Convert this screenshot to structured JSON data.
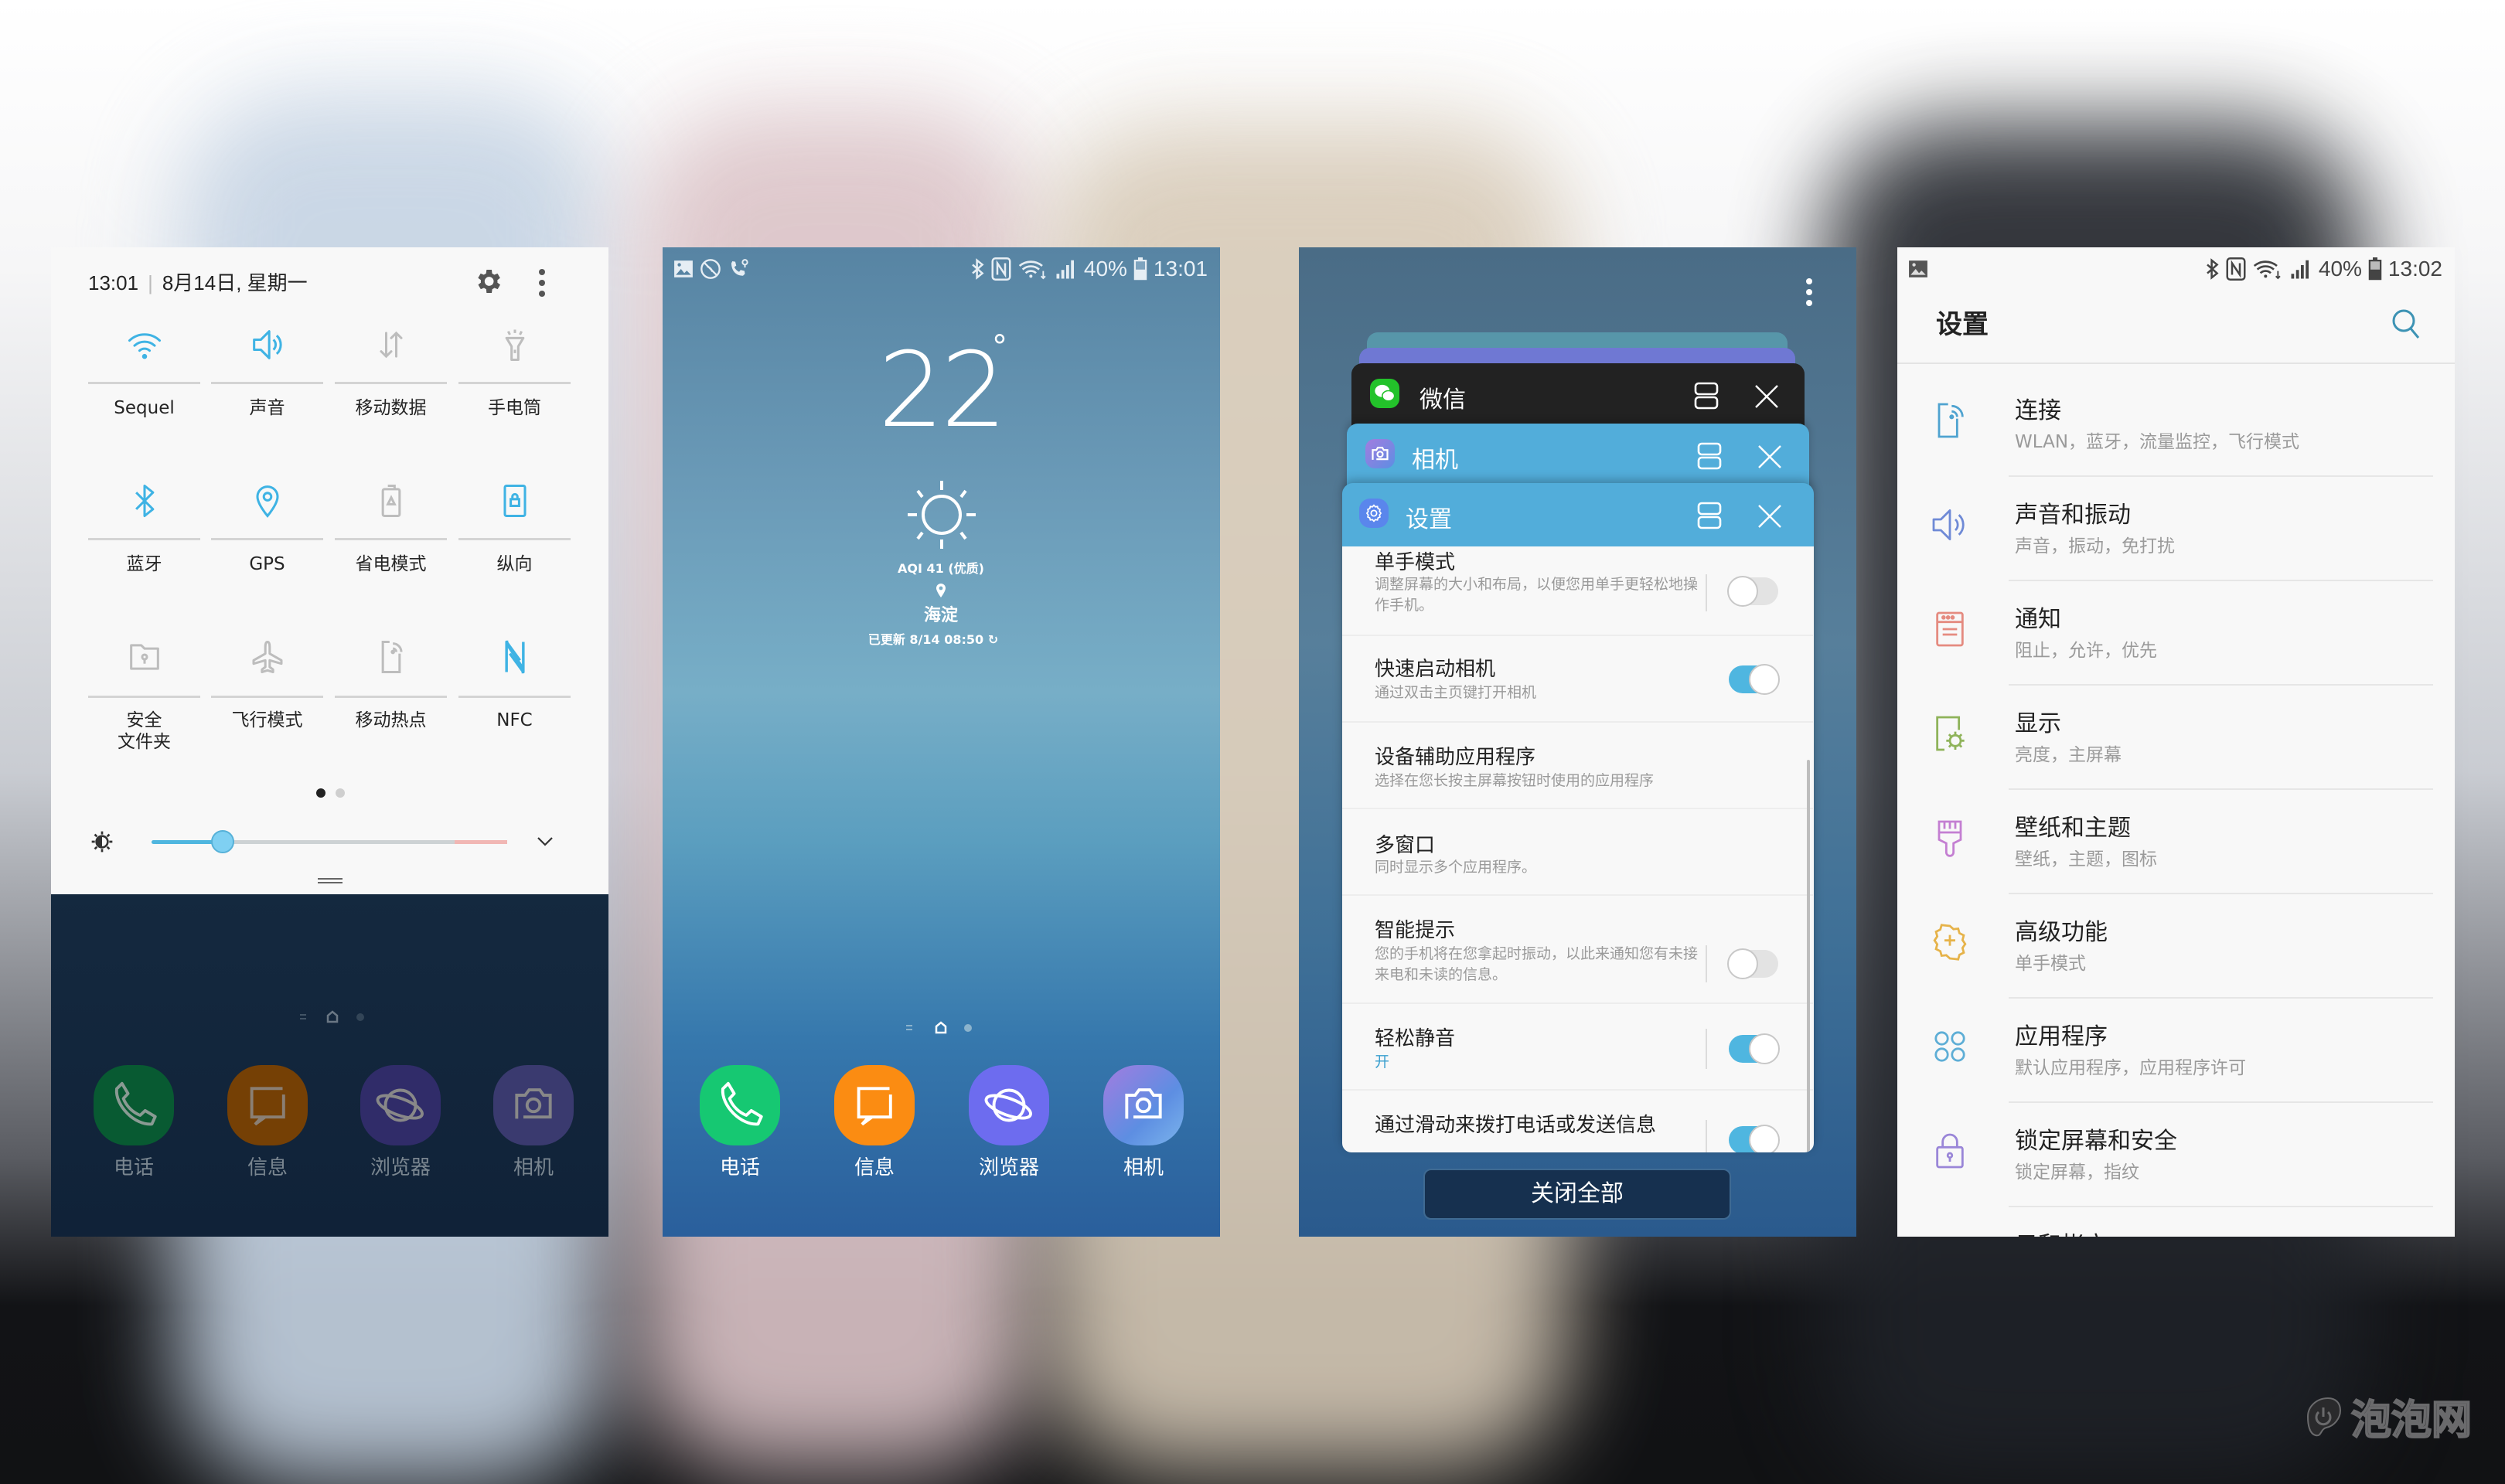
{
  "panel_quick_settings": {
    "time": "13:01",
    "date": "8月14日, 星期一",
    "tiles": [
      {
        "label": "Sequel",
        "icon": "wifi-icon",
        "active": true
      },
      {
        "label": "声音",
        "icon": "volume-icon",
        "active": true
      },
      {
        "label": "移动数据",
        "icon": "mobile-data-icon",
        "active": false
      },
      {
        "label": "手电筒",
        "icon": "flashlight-icon",
        "active": false
      },
      {
        "label": "蓝牙",
        "icon": "bluetooth-icon",
        "active": true
      },
      {
        "label": "GPS",
        "icon": "location-icon",
        "active": true
      },
      {
        "label": "省电模式",
        "icon": "power-saving-icon",
        "active": false
      },
      {
        "label": "纵向",
        "icon": "portrait-lock-icon",
        "active": true
      },
      {
        "label": "安全\n文件夹",
        "label_line1": "安全",
        "label_line2": "文件夹",
        "icon": "secure-folder-icon",
        "active": false
      },
      {
        "label": "飞行模式",
        "icon": "airplane-icon",
        "active": false
      },
      {
        "label": "移动热点",
        "icon": "hotspot-icon",
        "active": false
      },
      {
        "label": "NFC",
        "icon": "nfc-icon",
        "active": true
      }
    ],
    "page_indicator": {
      "current": 1,
      "total": 2
    },
    "brightness_level": 0.2,
    "dock": [
      {
        "label": "电话",
        "icon": "phone-icon"
      },
      {
        "label": "信息",
        "icon": "message-icon"
      },
      {
        "label": "浏览器",
        "icon": "browser-icon"
      },
      {
        "label": "相机",
        "icon": "camera-icon"
      }
    ]
  },
  "panel_home": {
    "status_bar": {
      "battery": "40%",
      "time": "13:01"
    },
    "weather": {
      "temperature": "22",
      "degree": "°",
      "condition_icon": "sun-icon",
      "aqi": "AQI 41 (优质)",
      "location": "海淀",
      "updated": "已更新 8/14 08:50"
    },
    "dock": [
      {
        "label": "电话",
        "icon": "phone-icon",
        "color": "#16c872"
      },
      {
        "label": "信息",
        "icon": "message-icon",
        "color": "#fb8c12"
      },
      {
        "label": "浏览器",
        "icon": "browser-icon",
        "color": "#6d6cef"
      },
      {
        "label": "相机",
        "icon": "camera-icon",
        "color": "#7f83e8"
      }
    ]
  },
  "panel_recents": {
    "apps": [
      {
        "name": "微信",
        "icon": "wechat-icon"
      },
      {
        "name": "相机",
        "icon": "camera-icon"
      },
      {
        "name": "设置",
        "icon": "settings-icon"
      }
    ],
    "settings_preview": [
      {
        "title": "单手模式",
        "desc": "调整屏幕的大小和布局，以便您用单手更轻松地操作手机。",
        "toggle": false
      },
      {
        "title": "快速启动相机",
        "desc": "通过双击主页键打开相机",
        "toggle": true
      },
      {
        "title": "设备辅助应用程序",
        "desc": "选择在您长按主屏幕按钮时使用的应用程序",
        "toggle": null
      },
      {
        "title": "多窗口",
        "desc": "同时显示多个应用程序。",
        "toggle": null
      },
      {
        "title": "智能提示",
        "desc": "您的手机将在您拿起时振动，以此来通知您有未接来电和未读的信息。",
        "toggle": false
      },
      {
        "title": "轻松静音",
        "desc": "开",
        "toggle": true
      },
      {
        "title": "通过滑动来拨打电话或发送信息",
        "desc": "",
        "toggle": true
      }
    ],
    "close_all_label": "关闭全部"
  },
  "panel_settings": {
    "status_bar": {
      "battery": "40%",
      "time": "13:02"
    },
    "title": "设置",
    "items": [
      {
        "title": "连接",
        "subtitle": "WLAN，蓝牙，流量监控，飞行模式",
        "icon": "connections-icon",
        "color": "#4fa3d0"
      },
      {
        "title": "声音和振动",
        "subtitle": "声音，振动，免打扰",
        "icon": "sound-icon",
        "color": "#6f8ad6"
      },
      {
        "title": "通知",
        "subtitle": "阻止，允许，优先",
        "icon": "notification-icon",
        "color": "#e58b80"
      },
      {
        "title": "显示",
        "subtitle": "亮度，主屏幕",
        "icon": "display-icon",
        "color": "#8fb35a"
      },
      {
        "title": "壁纸和主题",
        "subtitle": "壁纸，主题，图标",
        "icon": "wallpaper-icon",
        "color": "#c47fd2"
      },
      {
        "title": "高级功能",
        "subtitle": "单手模式",
        "icon": "advanced-features-icon",
        "color": "#e6b34a"
      },
      {
        "title": "应用程序",
        "subtitle": "默认应用程序，应用程序许可",
        "icon": "apps-icon",
        "color": "#5eaed6"
      },
      {
        "title": "锁定屏幕和安全",
        "subtitle": "锁定屏幕，指纹",
        "icon": "lock-icon",
        "color": "#9a86d8"
      },
      {
        "title": "云和帐户",
        "subtitle": "",
        "icon": "cloud-account-icon",
        "color": "#e8a267"
      }
    ]
  },
  "watermark": "泡泡网",
  "colors": {
    "accent": "#3fb3e4",
    "inactive": "#bdbdbd"
  }
}
